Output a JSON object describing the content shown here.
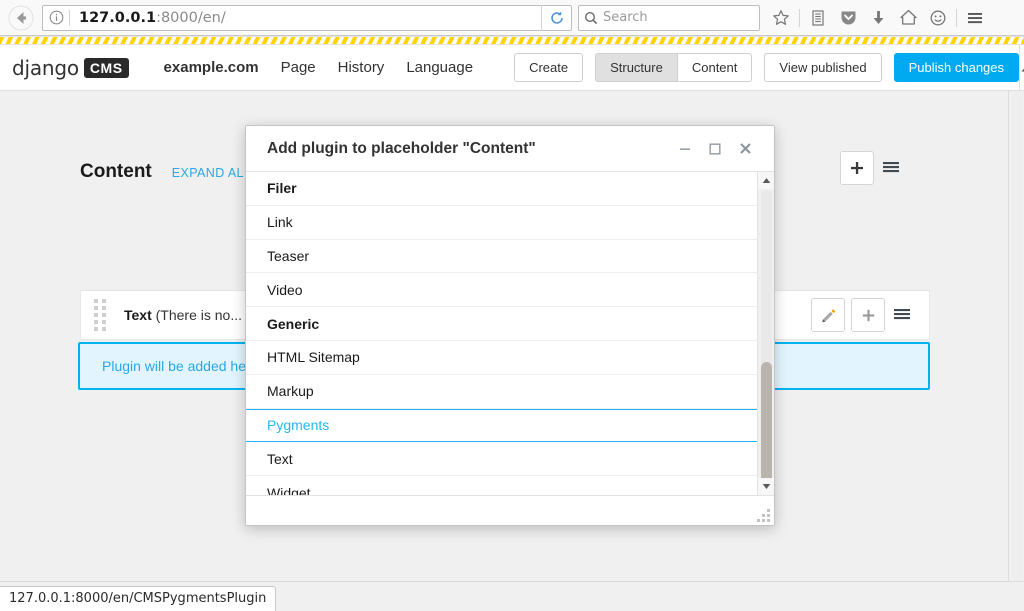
{
  "browser": {
    "back_icon": "back-arrow-icon",
    "identity_icon": "info-icon",
    "url_host": "127.0.0.1",
    "url_rest": ":8000/en/",
    "url_full": "127.0.0.1:8000/en/",
    "reload_icon": "reload-icon",
    "search_placeholder": "Search",
    "search_icon": "search-icon",
    "toolbar_icons": [
      {
        "name": "bookmark-star-icon"
      },
      {
        "name": "library-icon"
      },
      {
        "name": "pocket-shield-icon"
      },
      {
        "name": "downloads-icon"
      },
      {
        "name": "home-icon"
      },
      {
        "name": "sync-account-icon"
      },
      {
        "name": "hamburger-menu-icon"
      }
    ]
  },
  "cms_toolbar": {
    "brand_text": "django",
    "brand_badge": "CMS",
    "menu": [
      {
        "label": "example.com",
        "bold": true
      },
      {
        "label": "Page",
        "bold": false
      },
      {
        "label": "History",
        "bold": false
      },
      {
        "label": "Language",
        "bold": false
      }
    ],
    "create_label": "Create",
    "structure_label": "Structure",
    "content_label": "Content",
    "view_published_label": "View published",
    "publish_label": "Publish changes",
    "collapse_icon": "caret-up-icon",
    "accent_color": "#00aaf0"
  },
  "structure": {
    "placeholder_title": "Content",
    "expand_all_label": "EXPAND AL",
    "placeholder_add_icon": "plus-icon",
    "placeholder_menu_icon": "hamburger-icon",
    "plugin": {
      "drag_icon": "drag-handle-icon",
      "name": "Text",
      "description": "(There is no...",
      "edit_icon": "pencil-icon",
      "add_icon": "plus-icon",
      "menu_icon": "hamburger-icon"
    },
    "drop_zone_label": "Plugin will be added he",
    "drop_zone_border_color": "#00b4f0",
    "drop_zone_fill_color": "#e2f5fe"
  },
  "modal": {
    "title": "Add plugin to placeholder \"Content\"",
    "minimize_icon": "minimize-icon",
    "maximize_icon": "maximize-icon",
    "close_icon": "close-icon",
    "resize_icon": "resize-grip-icon",
    "scroll_up_icon": "scroll-up-arrow-icon",
    "scroll_down_icon": "scroll-down-arrow-icon",
    "selected_item": "Pygments",
    "selected_color": "#22b8f0",
    "items": [
      {
        "label": "Filer",
        "type": "group"
      },
      {
        "label": "Link",
        "type": "item"
      },
      {
        "label": "Teaser",
        "type": "item"
      },
      {
        "label": "Video",
        "type": "item"
      },
      {
        "label": "Generic",
        "type": "group"
      },
      {
        "label": "HTML Sitemap",
        "type": "item"
      },
      {
        "label": "Markup",
        "type": "item"
      },
      {
        "label": "Pygments",
        "type": "selected"
      },
      {
        "label": "Text",
        "type": "item"
      },
      {
        "label": "Widget",
        "type": "item"
      }
    ]
  },
  "statusbar": {
    "text": "127.0.0.1:8000/en/CMSPygmentsPlugin"
  }
}
